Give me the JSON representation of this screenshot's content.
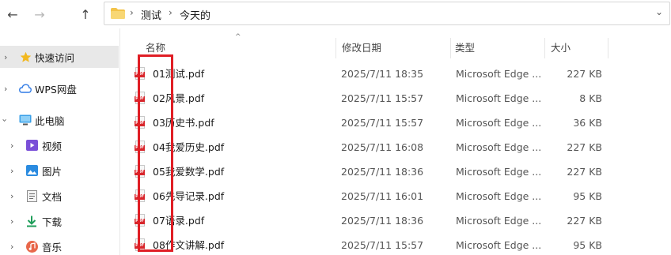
{
  "address_bar": {
    "back_glyph": "←",
    "forward_glyph": "→",
    "up_glyph": "↑",
    "chevron_glyph": "›",
    "dropdown_glyph": "⌄",
    "breadcrumbs": [
      "测试",
      "今天的"
    ]
  },
  "sidebar": {
    "items": [
      {
        "label": "快速访问",
        "icon": "star-icon",
        "selected": true
      },
      {
        "label": "WPS网盘",
        "icon": "cloud-icon"
      },
      {
        "label": "此电脑",
        "icon": "computer-icon",
        "expanded": true
      },
      {
        "label": "视频",
        "icon": "video-icon"
      },
      {
        "label": "图片",
        "icon": "picture-icon"
      },
      {
        "label": "文档",
        "icon": "document-icon"
      },
      {
        "label": "下载",
        "icon": "download-icon"
      },
      {
        "label": "音乐",
        "icon": "music-icon"
      }
    ]
  },
  "file_list": {
    "sort_glyph": "^",
    "columns": {
      "name": "名称",
      "date": "修改日期",
      "type": "类型",
      "size": "大小"
    },
    "pdf_tag": "PDF",
    "rows": [
      {
        "name": "01测试.pdf",
        "date": "2025/7/11 18:35",
        "type": "Microsoft Edge ...",
        "size": "227 KB"
      },
      {
        "name": "02风景.pdf",
        "date": "2025/7/11 15:57",
        "type": "Microsoft Edge ...",
        "size": "8 KB"
      },
      {
        "name": "03历史书.pdf",
        "date": "2025/7/11 15:57",
        "type": "Microsoft Edge ...",
        "size": "36 KB"
      },
      {
        "name": "04我爱历史.pdf",
        "date": "2025/7/11 16:08",
        "type": "Microsoft Edge ...",
        "size": "227 KB"
      },
      {
        "name": "05我爱数学.pdf",
        "date": "2025/7/11 18:36",
        "type": "Microsoft Edge ...",
        "size": "227 KB"
      },
      {
        "name": "06先导记录.pdf",
        "date": "2025/7/11 16:01",
        "type": "Microsoft Edge ...",
        "size": "95 KB"
      },
      {
        "name": "07语录.pdf",
        "date": "2025/7/11 18:36",
        "type": "Microsoft Edge ...",
        "size": "227 KB"
      },
      {
        "name": "08作文讲解.pdf",
        "date": "2025/7/11 15:57",
        "type": "Microsoft Edge ...",
        "size": "95 KB"
      }
    ]
  },
  "colors": {
    "highlight": "#e01e25",
    "pdf_red": "#d8262c",
    "folder_yellow": "#f3c34a",
    "selection": "#e8e8e8"
  }
}
